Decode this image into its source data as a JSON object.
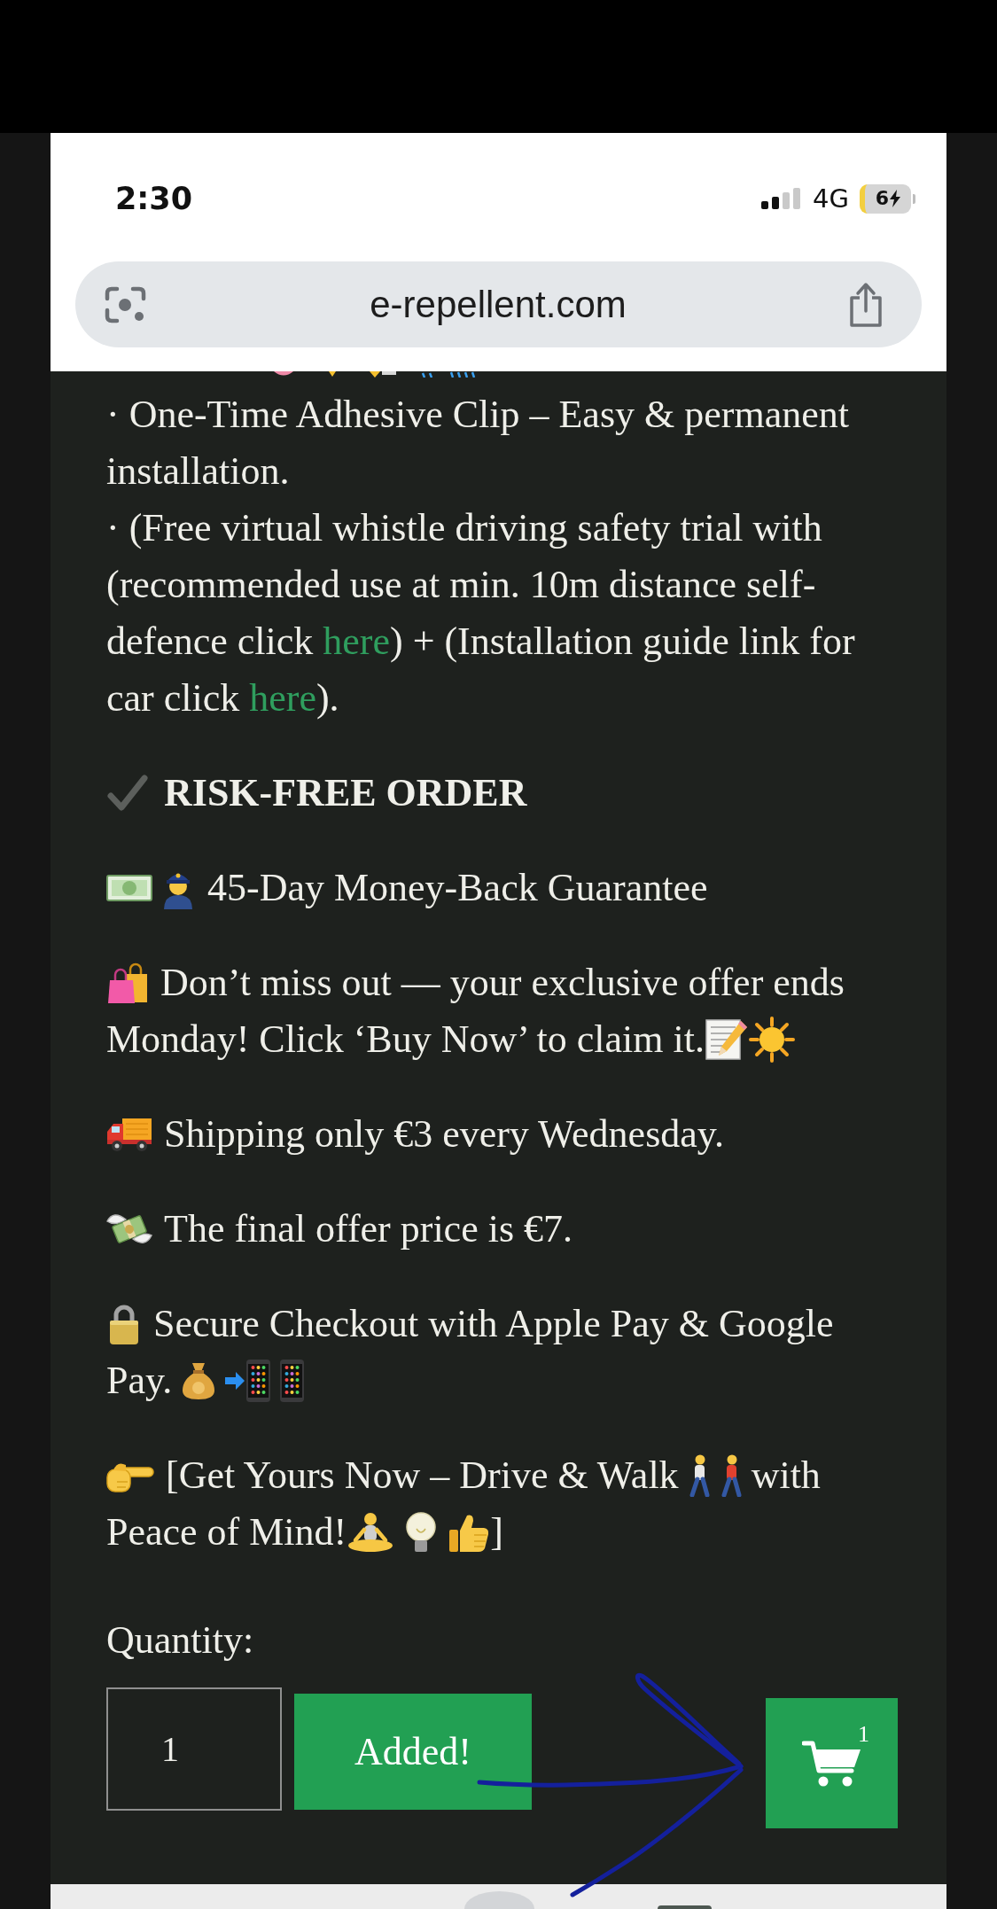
{
  "status_bar": {
    "time": "2:30",
    "network": "4G",
    "battery_percent": "6",
    "charging": true
  },
  "address_bar": {
    "url": "e-repellent.com"
  },
  "features": [
    {
      "segments": [
        {
          "kind": "text",
          "text": "· One-Time Adhesive Clip – Easy & permanent installation."
        }
      ]
    },
    {
      "segments": [
        {
          "kind": "text",
          "text": "· (Free virtual whistle driving safety trial with (recommended use at min. 10m distance self-defence click "
        },
        {
          "kind": "link",
          "text": "here"
        },
        {
          "kind": "text",
          "text": ") + (Installation guide link for car click "
        },
        {
          "kind": "link",
          "text": "here"
        },
        {
          "kind": "text",
          "text": ")."
        }
      ]
    }
  ],
  "heading": "RISK-FREE ORDER",
  "paragraphs": [
    {
      "lines": [
        "45-Day Money-Back Guarantee"
      ]
    },
    {
      "lines": [
        "Don’t miss out — your exclusive offer ends",
        "Monday! Click ‘Buy Now’ to claim it."
      ]
    },
    {
      "lines": [
        "Shipping only €3 every Wednesday."
      ]
    },
    {
      "lines": [
        "The final offer price is €7."
      ]
    },
    {
      "lines": [
        "Secure Checkout with Apple Pay & Google",
        "Pay."
      ]
    }
  ],
  "call_to_action": [
    "[Get Yours Now – Drive & Walk",
    "with",
    "Peace of Mind!",
    "]"
  ],
  "quantity": {
    "label": "Quantity:",
    "value": "1"
  },
  "add_button": {
    "label": "Added!"
  },
  "cart": {
    "count": "1"
  }
}
